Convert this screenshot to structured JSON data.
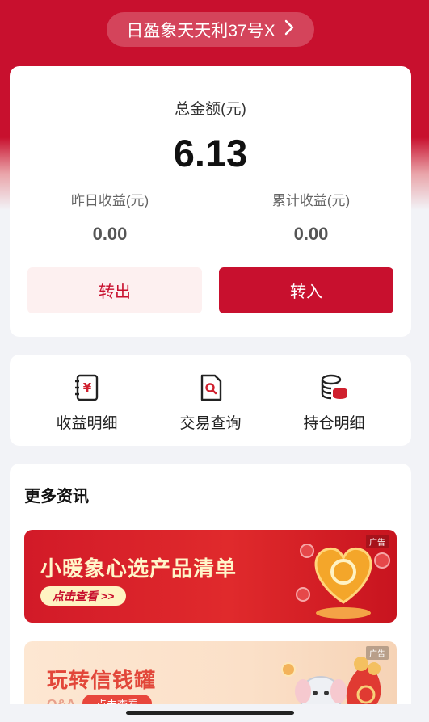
{
  "header": {
    "product_name": "日盈象天天利37号X",
    "chevron": "chevron-right-icon"
  },
  "balance": {
    "total_label": "总金额(元)",
    "total_value": "6.13",
    "yesterday_label": "昨日收益(元)",
    "yesterday_value": "0.00",
    "cumulative_label": "累计收益(元)",
    "cumulative_value": "0.00",
    "transfer_out_label": "转出",
    "transfer_in_label": "转入"
  },
  "menu": {
    "items": [
      {
        "label": "收益明细",
        "icon": "yuan-document-icon"
      },
      {
        "label": "交易查询",
        "icon": "search-document-icon"
      },
      {
        "label": "持仓明细",
        "icon": "coins-stack-icon"
      }
    ]
  },
  "news": {
    "title": "更多资讯",
    "banners": [
      {
        "ad_tag": "广告",
        "title": "小暖象心选产品清单",
        "cta": "点击查看 >>"
      },
      {
        "ad_tag": "广告",
        "title": "玩转信钱罐",
        "sub": "Q&A",
        "cta": "点击查看"
      }
    ]
  },
  "colors": {
    "brand_red": "#c8102e",
    "page_bg": "#f2f3f7"
  }
}
